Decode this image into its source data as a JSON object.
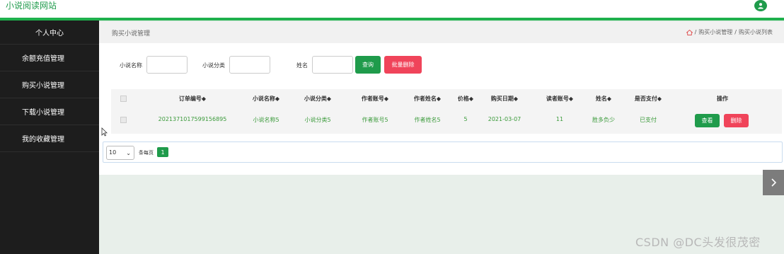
{
  "header": {
    "brand": "小说阅读网站"
  },
  "sidebar": {
    "items": [
      {
        "label": "个人中心"
      },
      {
        "label": "余额充值管理"
      },
      {
        "label": "购买小说管理"
      },
      {
        "label": "下载小说管理"
      },
      {
        "label": "我的收藏管理"
      }
    ]
  },
  "page": {
    "title": "购买小说管理",
    "breadcrumb": [
      "/",
      "购买小说管理",
      "/",
      "购买小说列表"
    ]
  },
  "search": {
    "novel_name_label": "小说名称",
    "novel_category_label": "小说分类",
    "name_label": "姓名",
    "query_button": "查询",
    "batch_delete_button": "批量删除"
  },
  "table": {
    "columns": [
      "订单编号◆",
      "小说名称◆",
      "小说分类◆",
      "作者账号◆",
      "作者姓名◆",
      "价格◆",
      "购买日期◆",
      "读者账号◆",
      "姓名◆",
      "是否支付◆",
      "操作"
    ],
    "rows": [
      {
        "order_no": "2021371017599156895",
        "novel_name": "小说名称5",
        "novel_category": "小说分类5",
        "author_account": "作者账号5",
        "author_name": "作者姓名5",
        "price": "5",
        "purchase_date": "2021-03-07",
        "reader_account": "11",
        "name": "胜多负少",
        "paid": "已支付",
        "view_button": "查看",
        "delete_button": "删除"
      }
    ]
  },
  "pagination": {
    "page_size": "10",
    "per_page_label": "条每页",
    "current_page": "1"
  },
  "watermark": "CSDN @DC头发很茂密",
  "colors": {
    "accent": "#1f9b4b",
    "danger": "#f0445a",
    "sidebar_bg": "#1d1d1d"
  }
}
